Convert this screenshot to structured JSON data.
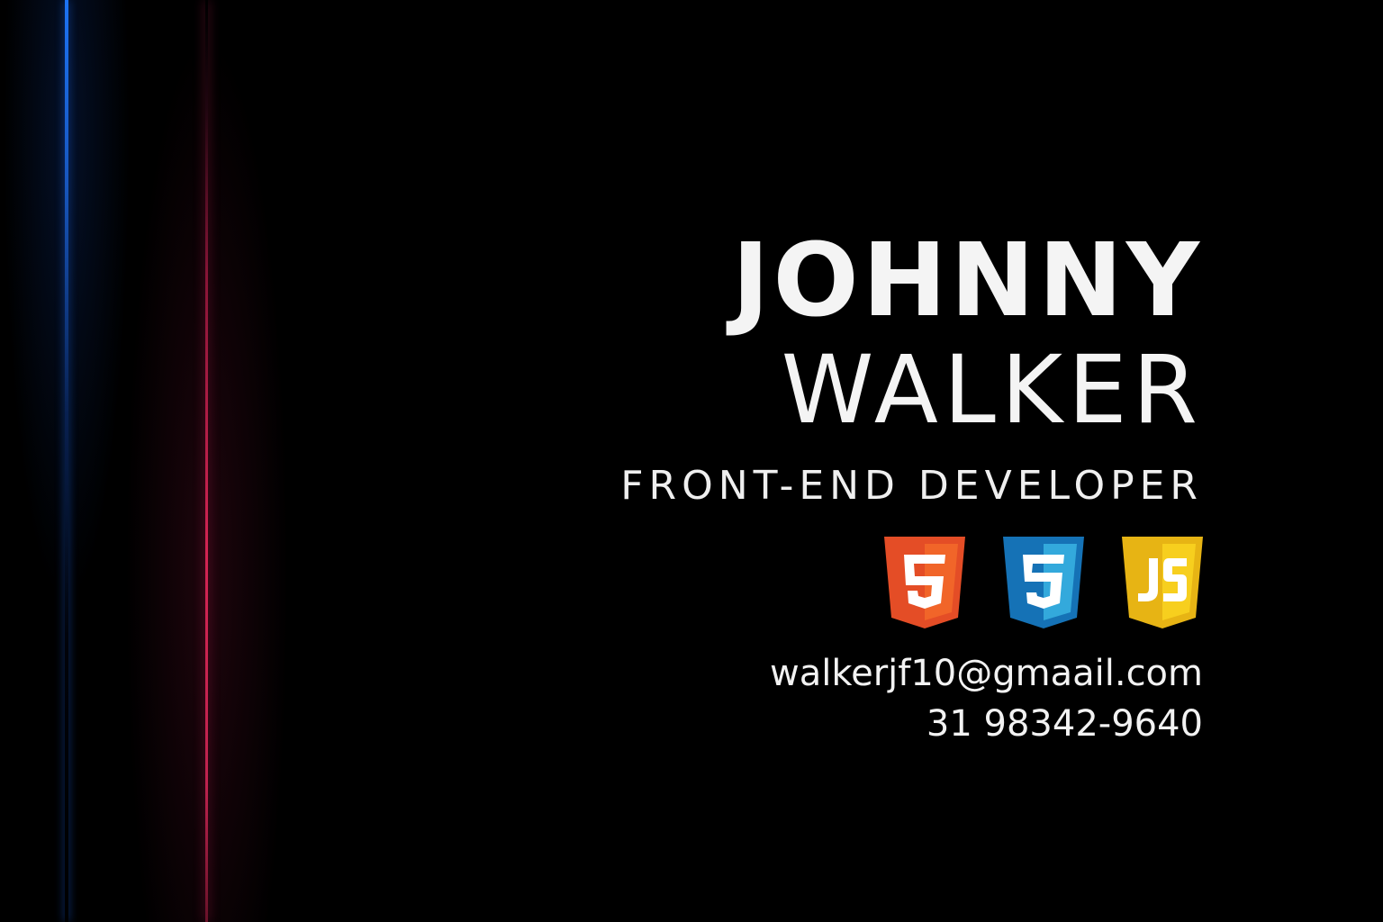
{
  "card": {
    "first_name": "JOHNNY",
    "last_name": "WALKER",
    "role": "FRONT-END DEVELOPER",
    "email": "walkerjf10@gmaail.com",
    "phone": "31 98342-9640",
    "badges": [
      {
        "name": "html5-icon",
        "glyph": "5",
        "color": "#E44D26",
        "shade": "#F16529"
      },
      {
        "name": "css3-icon",
        "glyph": "3",
        "color": "#1572B6",
        "shade": "#33A9DC"
      },
      {
        "name": "javascript-icon",
        "glyph": "JS",
        "color": "#E7B414",
        "shade": "#F7CF1E"
      }
    ],
    "colors": {
      "background": "#000000",
      "accent_blue": "#1E78FF",
      "accent_red": "#E6285A",
      "text": "#F2F2F2"
    }
  }
}
